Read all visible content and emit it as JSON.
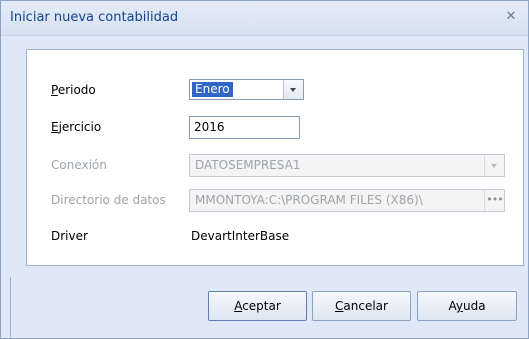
{
  "window": {
    "title": "Iniciar nueva contabilidad",
    "close_glyph": "✕"
  },
  "form": {
    "periodo": {
      "label": "Periodo",
      "value": "Enero"
    },
    "ejercicio": {
      "label": "Ejercicio",
      "value": "2016"
    },
    "conexion": {
      "label": "Conexión",
      "value": "DATOSEMPRESA1"
    },
    "directorio": {
      "label": "Directorio de datos",
      "value": "MMONTOYA:C:\\PROGRAM FILES (X86)\\",
      "button": "•••"
    },
    "driver": {
      "label": "Driver",
      "value": "DevartInterBase"
    }
  },
  "buttons": {
    "aceptar": "Aceptar",
    "cancelar": "Cancelar",
    "ayuda": "Ayuda"
  },
  "icons": {
    "close": "close-icon",
    "dropdown": "chevron-down-icon",
    "browse": "ellipsis-icon"
  }
}
